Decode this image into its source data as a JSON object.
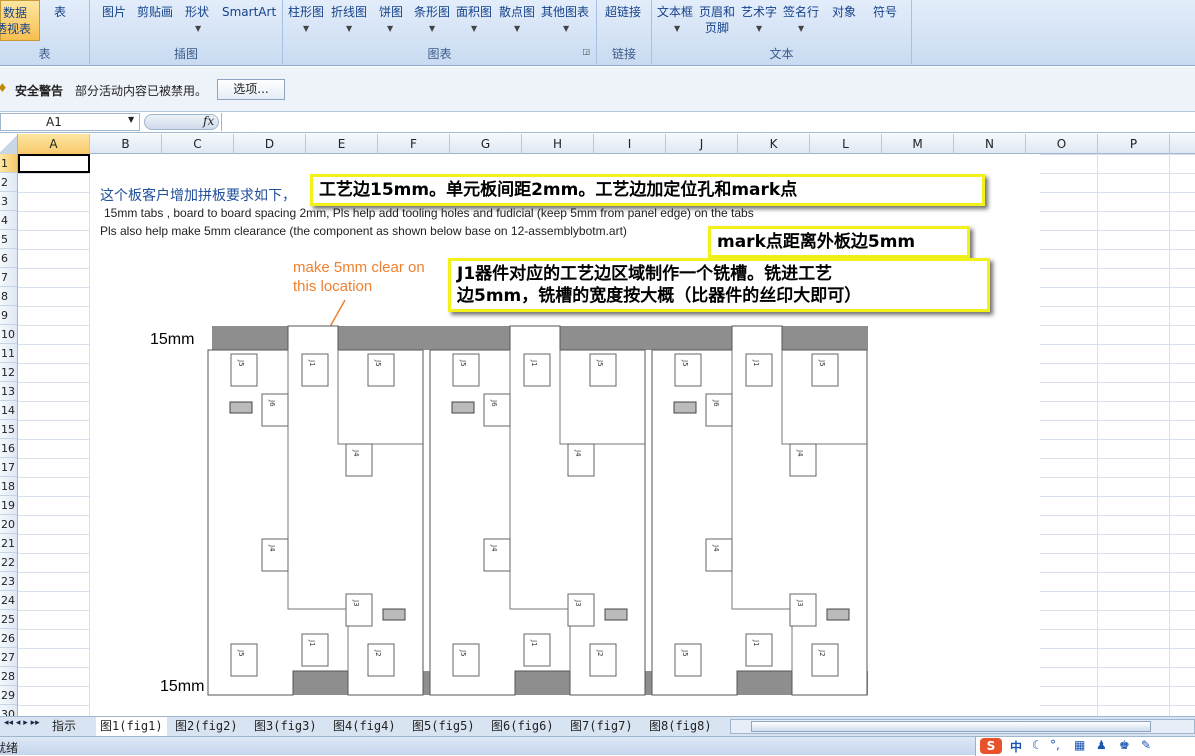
{
  "ribbon": {
    "left_labels": [
      "数据",
      "透视表"
    ],
    "table_btn": "表",
    "group_table": "表",
    "illus_items": [
      "图片",
      "剪贴画",
      "形状",
      "SmartArt"
    ],
    "group_illus": "插图",
    "chart_items": [
      "柱形图",
      "折线图",
      "饼图",
      "条形图",
      "面积图",
      "散点图",
      "其他图表"
    ],
    "group_chart": "图表",
    "link_item": "超链接",
    "group_link": "链接",
    "text_items": [
      "文本框",
      "页眉和\n页脚",
      "艺术字",
      "签名行",
      "对象",
      "符号"
    ],
    "group_text": "文本"
  },
  "security": {
    "title": "安全警告",
    "message": "部分活动内容已被禁用。",
    "options_btn": "选项..."
  },
  "formula": {
    "name_box": "A1",
    "fx": "fx",
    "value": ""
  },
  "columns": [
    "A",
    "B",
    "C",
    "D",
    "E",
    "F",
    "G",
    "H",
    "I",
    "J",
    "K",
    "L",
    "M",
    "N",
    "O",
    "P"
  ],
  "rows": [
    "1",
    "2",
    "3",
    "4",
    "5",
    "6",
    "7",
    "8",
    "9",
    "10",
    "11",
    "12",
    "13",
    "14",
    "15",
    "16",
    "17",
    "18",
    "19",
    "20",
    "21",
    "22",
    "23",
    "24",
    "25",
    "26",
    "27",
    "28",
    "29",
    "30"
  ],
  "picture": {
    "intro": "这个板客户增加拼板要求如下，",
    "line1": "15mm tabs , board to board spacing 2mm,  Pls help add tooling holes and fudicial (keep 5mm from panel edge) on the tabs",
    "line2": "Pls also help make 5mm clearance (the component as shown below  base on 12-assemblybotm.art)",
    "orange_note": "make 5mm clear on\nthis location",
    "top_label": "15mm",
    "bottom_label": "15mm",
    "component_labels": [
      "J1",
      "J2",
      "J3",
      "J4",
      "J5",
      "J6"
    ]
  },
  "callouts": {
    "c1": "工艺边15mm。单元板间距2mm。工艺边加定位孔和mark点",
    "c2": "mark点距离外板边5mm",
    "c3": "J1器件对应的工艺边区域制作一个铣槽。铣进工艺\n边5mm，铣槽的宽度按大概（比器件的丝印大即可）"
  },
  "sheets": [
    "指示",
    "图1(fig1)",
    "图2(fig2)",
    "图3(fig3)",
    "图4(fig4)",
    "图5(fig5)",
    "图6(fig6)",
    "图7(fig7)",
    "图8(fig8)"
  ],
  "status": {
    "ready": "就绪",
    "ime": "中"
  },
  "colors": {
    "ribbon": "#c9dbf1",
    "callout_border": "#f2f21a",
    "orange": "#f08030",
    "tab_gray": "#9a9a9a"
  }
}
